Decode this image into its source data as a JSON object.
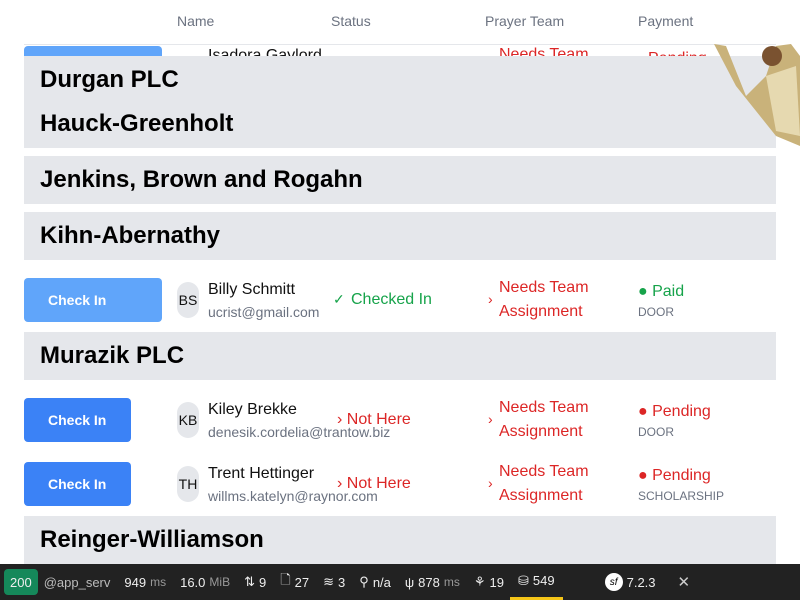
{
  "table": {
    "headers": [
      "Name",
      "Status",
      "Prayer Team",
      "Payment"
    ]
  },
  "partial_row": {
    "name": "Isadora Gaylord",
    "team": "Needs Team",
    "payment": "Pending"
  },
  "groups": [
    "Durgan PLC",
    "Hauck-Greenholt",
    "Jenkins, Brown and Rogahn",
    "Kihn-Abernathy",
    "Murazik PLC",
    "Reinger-Williamson"
  ],
  "rows": [
    {
      "button": "Check In",
      "initials": "BS",
      "name": "Billy Schmitt",
      "email": "ucrist@gmail.com",
      "status": "Checked In",
      "team_line1": "Needs Team",
      "team_line2": "Assignment",
      "payment": "Paid",
      "payment_type": "DOOR"
    },
    {
      "button": "Check In",
      "initials": "KB",
      "name": "Kiley Brekke",
      "email": "denesik.cordelia@trantow.biz",
      "status": "Not Here",
      "team_line1": "Needs Team",
      "team_line2": "Assignment",
      "payment": "Pending",
      "payment_type": "DOOR"
    },
    {
      "button": "Check In",
      "initials": "TH",
      "name": "Trent Hettinger",
      "email": "willms.katelyn@raynor.com",
      "status": "Not Here",
      "team_line1": "Needs Team",
      "team_line2": "Assignment",
      "payment": "Pending",
      "payment_type": "SCHOLARSHIP"
    }
  ],
  "toolbar": {
    "status_code": "200",
    "route": "@app_serv",
    "time": "949",
    "time_unit": "ms",
    "memory": "16.0",
    "memory_unit": "MiB",
    "requests": "9",
    "logs": "27",
    "cache": "3",
    "user": "n/a",
    "init_time": "878",
    "init_unit": "ms",
    "events": "19",
    "queries": "549",
    "version": "7.2.3",
    "close": "✕"
  },
  "colors": {
    "primary": "#3b82f6",
    "primary_light": "#60a5fa",
    "danger": "#dc2626",
    "success": "#16a34a"
  }
}
